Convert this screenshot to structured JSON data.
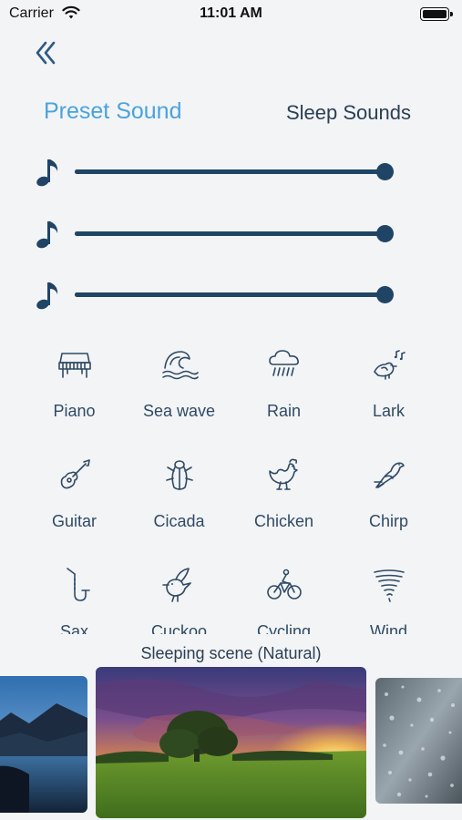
{
  "status_bar": {
    "carrier": "Carrier",
    "time": "11:01 AM",
    "icons": [
      "wifi-icon",
      "battery-icon"
    ]
  },
  "nav": {
    "back_icon": "double-chevron-left-icon"
  },
  "tabs": {
    "preset": "Preset Sound",
    "sleep": "Sleep Sounds",
    "active": "preset",
    "active_color": "#4aa3de"
  },
  "sliders": [
    {
      "icon": "music-note-icon",
      "level": 1.0
    },
    {
      "icon": "music-note-icon",
      "level": 1.0
    },
    {
      "icon": "music-note-icon",
      "level": 1.0
    }
  ],
  "sounds": [
    {
      "label": "Piano",
      "icon": "piano-icon"
    },
    {
      "label": "Sea wave",
      "icon": "sea-wave-icon"
    },
    {
      "label": "Rain",
      "icon": "rain-cloud-icon"
    },
    {
      "label": "Lark",
      "icon": "lark-bird-icon"
    },
    {
      "label": "Guitar",
      "icon": "guitar-icon"
    },
    {
      "label": "Cicada",
      "icon": "cicada-icon"
    },
    {
      "label": "Chicken",
      "icon": "chicken-icon"
    },
    {
      "label": "Chirp",
      "icon": "chirp-bird-icon"
    },
    {
      "label": "Sax",
      "icon": "saxophone-icon"
    },
    {
      "label": "Cuckoo",
      "icon": "cuckoo-bird-icon"
    },
    {
      "label": "Cycling",
      "icon": "cyclist-icon"
    },
    {
      "label": "Wind",
      "icon": "tornado-icon"
    }
  ],
  "scene": {
    "title": "Sleeping scene (Natural)",
    "images": [
      "lake-mountain-scene",
      "sunset-meadow-scene",
      "rain-window-scene"
    ]
  },
  "colors": {
    "primary": "#1f4466",
    "accent": "#4aa3de",
    "background": "#f3f4f6"
  }
}
